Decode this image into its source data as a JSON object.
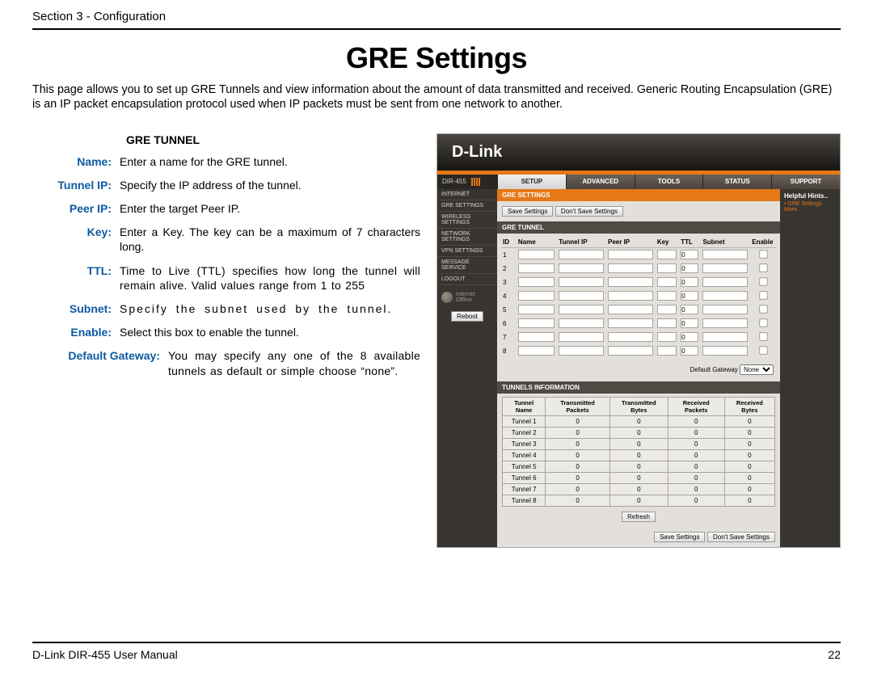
{
  "header": {
    "section": "Section 3 - Configuration"
  },
  "title": "GRE Settings",
  "intro": "This page allows you to set up GRE Tunnels and view information about the amount of data transmitted and received. Generic Routing Encapsulation (GRE) is an IP packet encapsulation protocol used when IP packets must be sent from one network to another.",
  "section_head": "GRE TUNNEL",
  "defs": {
    "name": {
      "label": "Name:",
      "desc": "Enter a name for the GRE tunnel."
    },
    "tunnel_ip": {
      "label": "Tunnel IP:",
      "desc": "Specify the IP address of the tunnel."
    },
    "peer_ip": {
      "label": "Peer IP:",
      "desc": "Enter the target Peer IP."
    },
    "key": {
      "label": "Key:",
      "desc": "Enter a Key. The key can be a maximum of 7 characters long."
    },
    "ttl": {
      "label": "TTL:",
      "desc": "Time to Live (TTL) specifies how long the tunnel will remain alive. Valid values range from 1 to 255"
    },
    "subnet": {
      "label": "Subnet:",
      "desc": "Specify the subnet used by the tunnel."
    },
    "enable": {
      "label": "Enable:",
      "desc": "Select this box to enable the tunnel."
    },
    "default_gateway": {
      "label": "Default Gateway:",
      "desc": "You may specify any one of the 8 available tunnels as default or simple choose “none”."
    }
  },
  "screenshot": {
    "brand": "D-Link",
    "device": "DIR-455",
    "tabs": [
      "SETUP",
      "ADVANCED",
      "TOOLS",
      "STATUS",
      "SUPPORT"
    ],
    "active_tab": 0,
    "sidenav": [
      "INTERNET",
      "GRE SETTINGS",
      "WIRELESS SETTINGS",
      "NETWORK SETTINGS",
      "VPN SETTINGS",
      "MESSAGE SERVICE",
      "LOGOUT"
    ],
    "net_status": {
      "line1": "Internet",
      "line2": "Offline"
    },
    "reboot": "Reboot",
    "bar_title": "GRE SETTINGS",
    "save": "Save Settings",
    "dont_save": "Don't Save Settings",
    "gre_header": "GRE TUNNEL",
    "gre_cols": [
      "ID",
      "Name",
      "Tunnel IP",
      "Peer IP",
      "Key",
      "TTL",
      "Subnet",
      "Enable"
    ],
    "gre_rows": [
      {
        "id": "1",
        "ttl": "0"
      },
      {
        "id": "2",
        "ttl": "0"
      },
      {
        "id": "3",
        "ttl": "0"
      },
      {
        "id": "4",
        "ttl": "0"
      },
      {
        "id": "5",
        "ttl": "0"
      },
      {
        "id": "6",
        "ttl": "0"
      },
      {
        "id": "7",
        "ttl": "0"
      },
      {
        "id": "8",
        "ttl": "0"
      }
    ],
    "dgw_label": "Default Gateway",
    "dgw_value": "None",
    "ti_header": "TUNNELS INFORMATION",
    "ti_cols": [
      "Tunnel Name",
      "Transmitted Packets",
      "Transmitted Bytes",
      "Received Packets",
      "Received Bytes"
    ],
    "ti_rows": [
      {
        "name": "Tunnel 1",
        "tp": "0",
        "tb": "0",
        "rp": "0",
        "rb": "0"
      },
      {
        "name": "Tunnel 2",
        "tp": "0",
        "tb": "0",
        "rp": "0",
        "rb": "0"
      },
      {
        "name": "Tunnel 3",
        "tp": "0",
        "tb": "0",
        "rp": "0",
        "rb": "0"
      },
      {
        "name": "Tunnel 4",
        "tp": "0",
        "tb": "0",
        "rp": "0",
        "rb": "0"
      },
      {
        "name": "Tunnel 5",
        "tp": "0",
        "tb": "0",
        "rp": "0",
        "rb": "0"
      },
      {
        "name": "Tunnel 6",
        "tp": "0",
        "tb": "0",
        "rp": "0",
        "rb": "0"
      },
      {
        "name": "Tunnel 7",
        "tp": "0",
        "tb": "0",
        "rp": "0",
        "rb": "0"
      },
      {
        "name": "Tunnel 8",
        "tp": "0",
        "tb": "0",
        "rp": "0",
        "rb": "0"
      }
    ],
    "refresh": "Refresh",
    "hints": {
      "title": "Helpful Hints..",
      "item": "• GRE Settings",
      "more": "More.."
    }
  },
  "footer": {
    "left": "D-Link DIR-455 User Manual",
    "right": "22"
  }
}
